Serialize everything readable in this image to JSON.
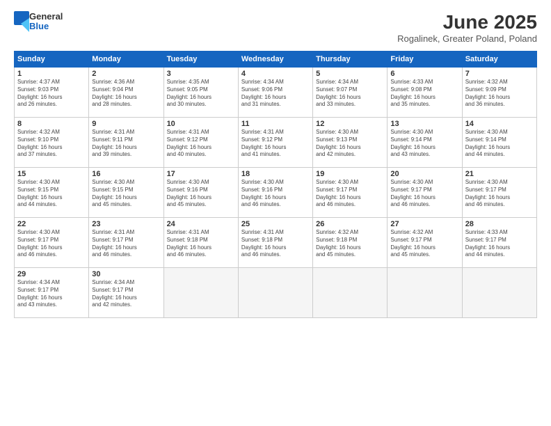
{
  "header": {
    "logo_general": "General",
    "logo_blue": "Blue",
    "month_year": "June 2025",
    "location": "Rogalinek, Greater Poland, Poland"
  },
  "weekdays": [
    "Sunday",
    "Monday",
    "Tuesday",
    "Wednesday",
    "Thursday",
    "Friday",
    "Saturday"
  ],
  "weeks": [
    [
      {
        "day": "1",
        "info": "Sunrise: 4:37 AM\nSunset: 9:03 PM\nDaylight: 16 hours\nand 26 minutes."
      },
      {
        "day": "2",
        "info": "Sunrise: 4:36 AM\nSunset: 9:04 PM\nDaylight: 16 hours\nand 28 minutes."
      },
      {
        "day": "3",
        "info": "Sunrise: 4:35 AM\nSunset: 9:05 PM\nDaylight: 16 hours\nand 30 minutes."
      },
      {
        "day": "4",
        "info": "Sunrise: 4:34 AM\nSunset: 9:06 PM\nDaylight: 16 hours\nand 31 minutes."
      },
      {
        "day": "5",
        "info": "Sunrise: 4:34 AM\nSunset: 9:07 PM\nDaylight: 16 hours\nand 33 minutes."
      },
      {
        "day": "6",
        "info": "Sunrise: 4:33 AM\nSunset: 9:08 PM\nDaylight: 16 hours\nand 35 minutes."
      },
      {
        "day": "7",
        "info": "Sunrise: 4:32 AM\nSunset: 9:09 PM\nDaylight: 16 hours\nand 36 minutes."
      }
    ],
    [
      {
        "day": "8",
        "info": "Sunrise: 4:32 AM\nSunset: 9:10 PM\nDaylight: 16 hours\nand 37 minutes."
      },
      {
        "day": "9",
        "info": "Sunrise: 4:31 AM\nSunset: 9:11 PM\nDaylight: 16 hours\nand 39 minutes."
      },
      {
        "day": "10",
        "info": "Sunrise: 4:31 AM\nSunset: 9:12 PM\nDaylight: 16 hours\nand 40 minutes."
      },
      {
        "day": "11",
        "info": "Sunrise: 4:31 AM\nSunset: 9:12 PM\nDaylight: 16 hours\nand 41 minutes."
      },
      {
        "day": "12",
        "info": "Sunrise: 4:30 AM\nSunset: 9:13 PM\nDaylight: 16 hours\nand 42 minutes."
      },
      {
        "day": "13",
        "info": "Sunrise: 4:30 AM\nSunset: 9:14 PM\nDaylight: 16 hours\nand 43 minutes."
      },
      {
        "day": "14",
        "info": "Sunrise: 4:30 AM\nSunset: 9:14 PM\nDaylight: 16 hours\nand 44 minutes."
      }
    ],
    [
      {
        "day": "15",
        "info": "Sunrise: 4:30 AM\nSunset: 9:15 PM\nDaylight: 16 hours\nand 44 minutes."
      },
      {
        "day": "16",
        "info": "Sunrise: 4:30 AM\nSunset: 9:15 PM\nDaylight: 16 hours\nand 45 minutes."
      },
      {
        "day": "17",
        "info": "Sunrise: 4:30 AM\nSunset: 9:16 PM\nDaylight: 16 hours\nand 45 minutes."
      },
      {
        "day": "18",
        "info": "Sunrise: 4:30 AM\nSunset: 9:16 PM\nDaylight: 16 hours\nand 46 minutes."
      },
      {
        "day": "19",
        "info": "Sunrise: 4:30 AM\nSunset: 9:17 PM\nDaylight: 16 hours\nand 46 minutes."
      },
      {
        "day": "20",
        "info": "Sunrise: 4:30 AM\nSunset: 9:17 PM\nDaylight: 16 hours\nand 46 minutes."
      },
      {
        "day": "21",
        "info": "Sunrise: 4:30 AM\nSunset: 9:17 PM\nDaylight: 16 hours\nand 46 minutes."
      }
    ],
    [
      {
        "day": "22",
        "info": "Sunrise: 4:30 AM\nSunset: 9:17 PM\nDaylight: 16 hours\nand 46 minutes."
      },
      {
        "day": "23",
        "info": "Sunrise: 4:31 AM\nSunset: 9:17 PM\nDaylight: 16 hours\nand 46 minutes."
      },
      {
        "day": "24",
        "info": "Sunrise: 4:31 AM\nSunset: 9:18 PM\nDaylight: 16 hours\nand 46 minutes."
      },
      {
        "day": "25",
        "info": "Sunrise: 4:31 AM\nSunset: 9:18 PM\nDaylight: 16 hours\nand 46 minutes."
      },
      {
        "day": "26",
        "info": "Sunrise: 4:32 AM\nSunset: 9:18 PM\nDaylight: 16 hours\nand 45 minutes."
      },
      {
        "day": "27",
        "info": "Sunrise: 4:32 AM\nSunset: 9:17 PM\nDaylight: 16 hours\nand 45 minutes."
      },
      {
        "day": "28",
        "info": "Sunrise: 4:33 AM\nSunset: 9:17 PM\nDaylight: 16 hours\nand 44 minutes."
      }
    ],
    [
      {
        "day": "29",
        "info": "Sunrise: 4:34 AM\nSunset: 9:17 PM\nDaylight: 16 hours\nand 43 minutes."
      },
      {
        "day": "30",
        "info": "Sunrise: 4:34 AM\nSunset: 9:17 PM\nDaylight: 16 hours\nand 42 minutes."
      },
      {
        "day": "",
        "info": ""
      },
      {
        "day": "",
        "info": ""
      },
      {
        "day": "",
        "info": ""
      },
      {
        "day": "",
        "info": ""
      },
      {
        "day": "",
        "info": ""
      }
    ]
  ]
}
